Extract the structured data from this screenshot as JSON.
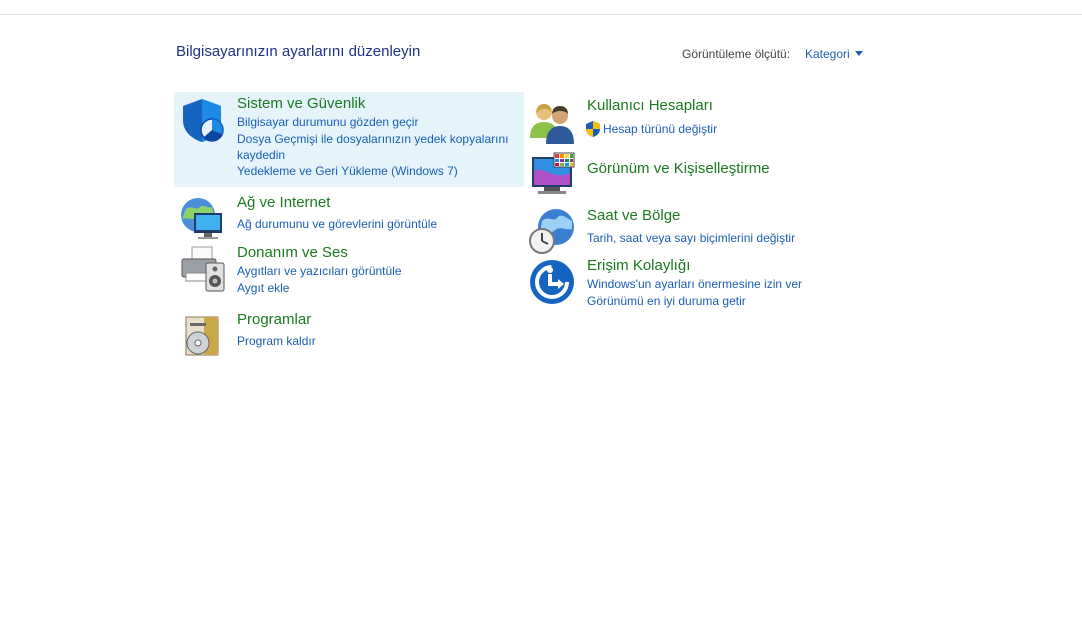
{
  "header": {
    "title": "Bilgisayarınızın ayarlarını düzenleyin",
    "view_by_label": "Görüntüleme ölçütü:",
    "view_by_value": "Kategori"
  },
  "left": [
    {
      "title": "Sistem ve Güvenlik",
      "icon": "security-shield-icon",
      "links": [
        "Bilgisayar durumunu gözden geçir",
        "Dosya Geçmişi ile dosyalarınızın yedek kopyalarını kaydedin",
        "Yedekleme ve Geri Yükleme (Windows 7)"
      ]
    },
    {
      "title": "Ağ ve Internet",
      "icon": "network-globe-icon",
      "links": [
        "Ağ durumunu ve görevlerini görüntüle"
      ]
    },
    {
      "title": "Donanım ve Ses",
      "icon": "printer-speaker-icon",
      "links": [
        "Aygıtları ve yazıcıları görüntüle",
        "Aygıt ekle"
      ]
    },
    {
      "title": "Programlar",
      "icon": "programs-disc-icon",
      "links": [
        "Program kaldır"
      ]
    }
  ],
  "right": [
    {
      "title": "Kullanıcı Hesapları",
      "icon": "users-icon",
      "links": [
        "Hesap türünü değiştir"
      ]
    },
    {
      "title": "Görünüm ve Kişiselleştirme",
      "icon": "monitor-palette-icon",
      "links": []
    },
    {
      "title": "Saat ve Bölge",
      "icon": "globe-clock-icon",
      "links": [
        "Tarih, saat veya sayı biçimlerini değiştir"
      ]
    },
    {
      "title": "Erişim Kolaylığı",
      "icon": "accessibility-icon",
      "links": [
        "Windows'un ayarları önermesine izin ver",
        "Görünümü en iyi duruma getir"
      ]
    }
  ],
  "colors": {
    "title_green": "#1a7a1f",
    "link_blue": "#1a5fb4",
    "highlight": "#e5f3fb"
  }
}
